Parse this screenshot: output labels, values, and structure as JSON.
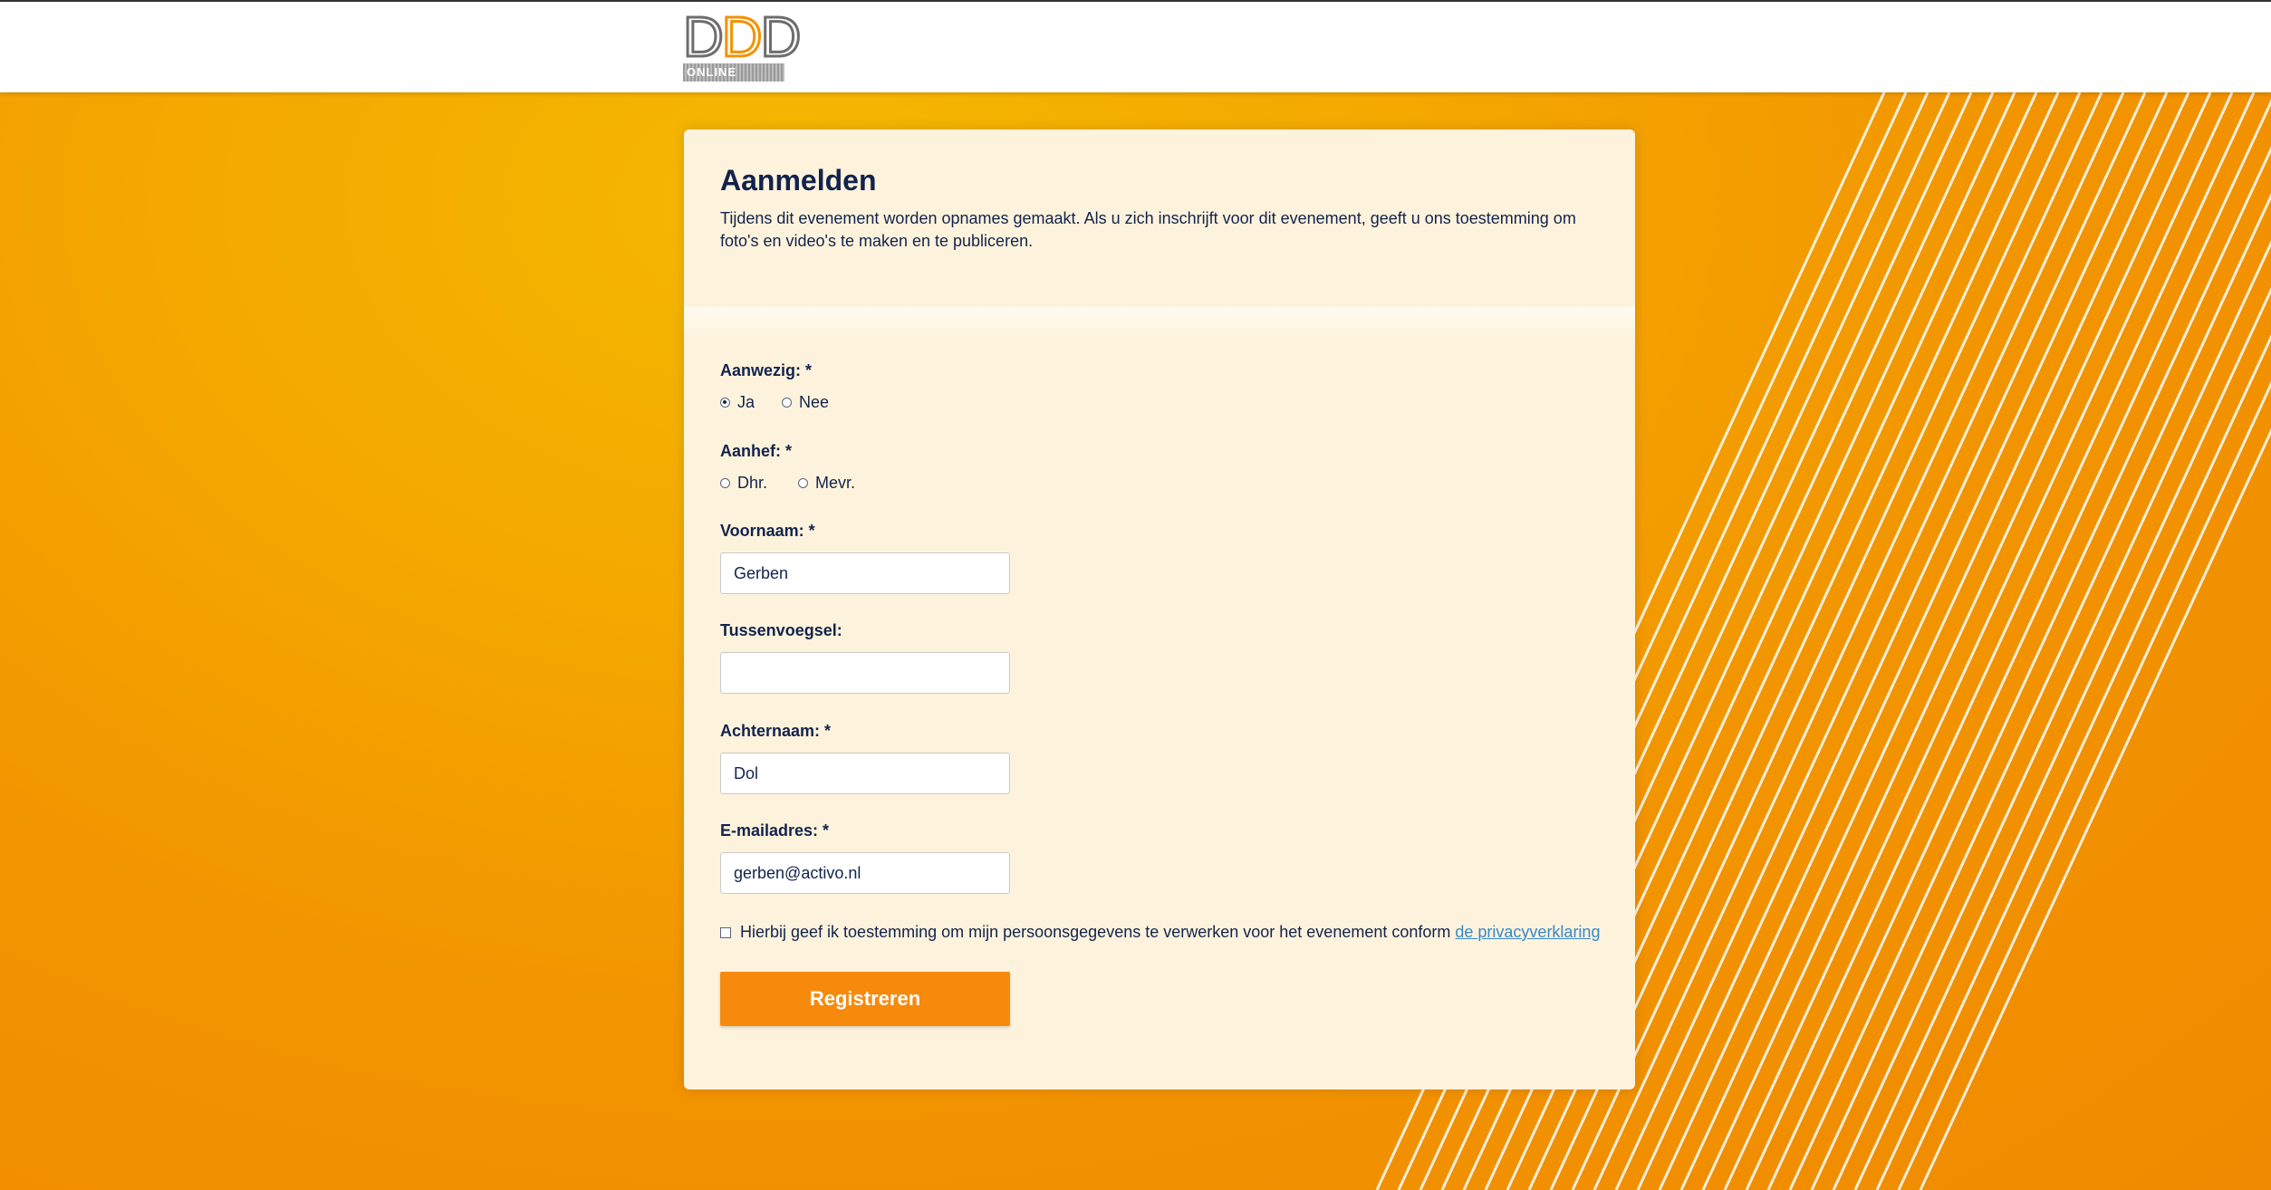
{
  "logo": {
    "letters": [
      "D",
      "D",
      "D"
    ],
    "sub": "ONLINE"
  },
  "form": {
    "title": "Aanmelden",
    "intro": "Tijdens dit evenement worden opnames gemaakt. Als u zich inschrijft voor dit evenement, geeft u ons toestemming om foto's en video's te maken en te publiceren.",
    "attendance": {
      "label": "Aanwezig: *",
      "options": [
        {
          "label": "Ja",
          "checked": true
        },
        {
          "label": "Nee",
          "checked": false
        }
      ]
    },
    "salutation": {
      "label": "Aanhef: *",
      "options": [
        {
          "label": "Dhr.",
          "checked": false
        },
        {
          "label": "Mevr.",
          "checked": false
        }
      ]
    },
    "first_name": {
      "label": "Voornaam: *",
      "value": "Gerben"
    },
    "infix": {
      "label": "Tussenvoegsel:",
      "value": ""
    },
    "last_name": {
      "label": "Achternaam: *",
      "value": "Dol"
    },
    "email": {
      "label": "E-mailadres: *",
      "value": "gerben@activo.nl"
    },
    "consent": {
      "text": "Hierbij geef ik toestemming om mijn persoonsgegevens te verwerken voor het evenement conform",
      "link": "de privacyverklaring",
      "checked": false
    },
    "submit_label": "Registreren"
  },
  "colors": {
    "brand_orange": "#f39200",
    "button": "#f7890d",
    "heading": "#13234d",
    "link": "#3a87c7",
    "card": "#fdf3dc"
  }
}
